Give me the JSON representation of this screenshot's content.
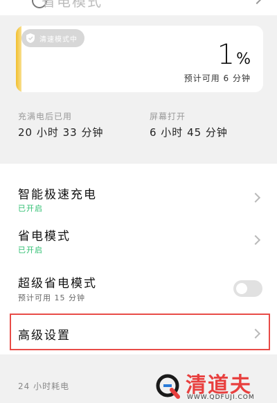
{
  "top_row": {
    "text": "省电模式"
  },
  "battery": {
    "mode_badge": "清速模式中",
    "percent": "1",
    "percent_unit": "%",
    "level_fraction": 0.01,
    "estimate": "预计可用 6 分钟",
    "bar_color": "#f2bf2e"
  },
  "stats": {
    "since_full": {
      "label": "充满电后已用",
      "value": "20 小时 33 分钟"
    },
    "screen_on": {
      "label": "屏幕打开",
      "value": "6 小时 45 分钟"
    }
  },
  "settings": {
    "smart_fast_charge": {
      "title": "智能极速充电",
      "status": "已开启"
    },
    "power_saving": {
      "title": "省电模式",
      "status": "已开启"
    },
    "super_power_saving": {
      "title": "超级省电模式",
      "subtitle": "预计可用 15 分钟",
      "enabled": false
    },
    "advanced": {
      "title": "高级设置"
    }
  },
  "section": {
    "label": "24 小时耗电"
  },
  "watermark": {
    "name": "清道夫",
    "url": "WWW.QDFUJI.COM"
  },
  "colors": {
    "accent_green": "#2fbf71",
    "highlight_red": "#e84b47",
    "watermark_red": "#e8403f"
  }
}
